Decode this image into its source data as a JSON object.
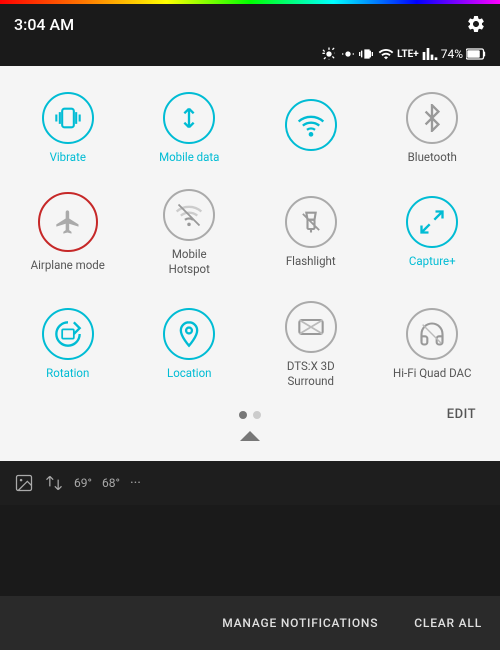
{
  "status_bar": {
    "time": "3:04 AM",
    "battery": "74%",
    "gear_label": "settings"
  },
  "quick_settings": {
    "items": [
      {
        "id": "vibrate",
        "label": "Vibrate",
        "state": "active",
        "icon": "vibrate"
      },
      {
        "id": "mobile_data",
        "label": "Mobile data",
        "state": "active",
        "icon": "mobile_data"
      },
      {
        "id": "wifi",
        "label": "",
        "state": "active",
        "icon": "wifi"
      },
      {
        "id": "bluetooth",
        "label": "Bluetooth",
        "state": "inactive",
        "icon": "bluetooth"
      },
      {
        "id": "airplane",
        "label": "Airplane mode",
        "state": "special",
        "icon": "airplane"
      },
      {
        "id": "mobile_hotspot",
        "label": "Mobile\nHotspot",
        "state": "inactive",
        "icon": "hotspot"
      },
      {
        "id": "flashlight",
        "label": "Flashlight",
        "state": "inactive",
        "icon": "flashlight"
      },
      {
        "id": "capture",
        "label": "Capture+",
        "state": "active",
        "icon": "capture"
      },
      {
        "id": "rotation",
        "label": "Rotation",
        "state": "active",
        "icon": "rotation"
      },
      {
        "id": "location",
        "label": "Location",
        "state": "active",
        "icon": "location"
      },
      {
        "id": "dts",
        "label": "DTS:X 3D\nSurround",
        "state": "inactive",
        "icon": "dts"
      },
      {
        "id": "hifi",
        "label": "Hi-Fi Quad DAC",
        "state": "inactive",
        "icon": "hifi"
      }
    ],
    "dots": [
      {
        "active": true
      },
      {
        "active": false
      }
    ],
    "edit_label": "EDIT"
  },
  "notification": {
    "icons": [
      "image",
      "swap",
      "temp1",
      "temp2",
      "more"
    ],
    "text1": "69°",
    "text2": "68°"
  },
  "bottom_bar": {
    "manage_label": "MANAGE NOTIFICATIONS",
    "clear_label": "CLEAR ALL"
  }
}
